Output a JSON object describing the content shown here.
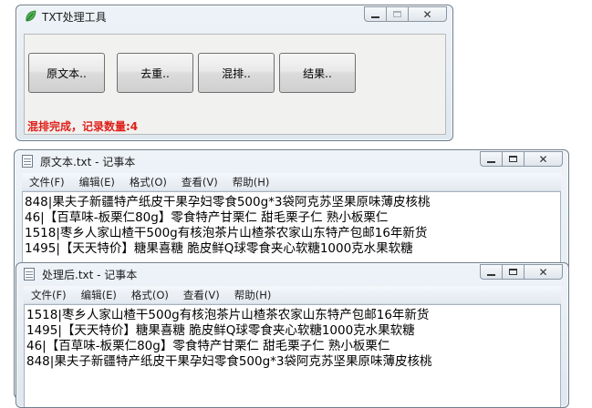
{
  "tool_window": {
    "title": "TXT处理工具",
    "buttons": {
      "original": "原文本..",
      "dedup": "去重..",
      "shuffle": "混排..",
      "result": "结果.."
    },
    "status": "混排完成，记录数量:4"
  },
  "notepad_original": {
    "title": "原文本.txt - 记事本",
    "menu": [
      "文件(F)",
      "编辑(E)",
      "格式(O)",
      "查看(V)",
      "帮助(H)"
    ],
    "lines": [
      "848|果夫子新疆特产纸皮干果孕妇零食500g*3袋阿克苏坚果原味薄皮核桃",
      "46|【百草味-板栗仁80g】零食特产甘栗仁 甜毛栗子仁 熟小板栗仁",
      "1518|枣乡人家山楂干500g有核泡茶片山楂茶农家山东特产包邮16年新货",
      "1495|【天天特价】糖果喜糖 脆皮鲜Q球零食夹心软糖1000克水果软糖"
    ]
  },
  "notepad_result": {
    "title": "处理后.txt - 记事本",
    "menu": [
      "文件(F)",
      "编辑(E)",
      "格式(O)",
      "查看(V)",
      "帮助(H)"
    ],
    "lines": [
      "1518|枣乡人家山楂干500g有核泡茶片山楂茶农家山东特产包邮16年新货",
      "1495|【天天特价】糖果喜糖 脆皮鲜Q球零食夹心软糖1000克水果软糖",
      "46|【百草味-板栗仁80g】零食特产甘栗仁 甜毛栗子仁 熟小板栗仁",
      "848|果夫子新疆特产纸皮干果孕妇零食500g*3袋阿克苏坚果原味薄皮核桃"
    ]
  },
  "colors": {
    "status": "#e0201a",
    "leaf_icon": "#4caf50"
  },
  "icons": {
    "tool": "leaf-icon",
    "notepad": "notepad-icon",
    "minimize": "minimize-icon",
    "maximize": "maximize-icon",
    "close": "close-icon"
  }
}
